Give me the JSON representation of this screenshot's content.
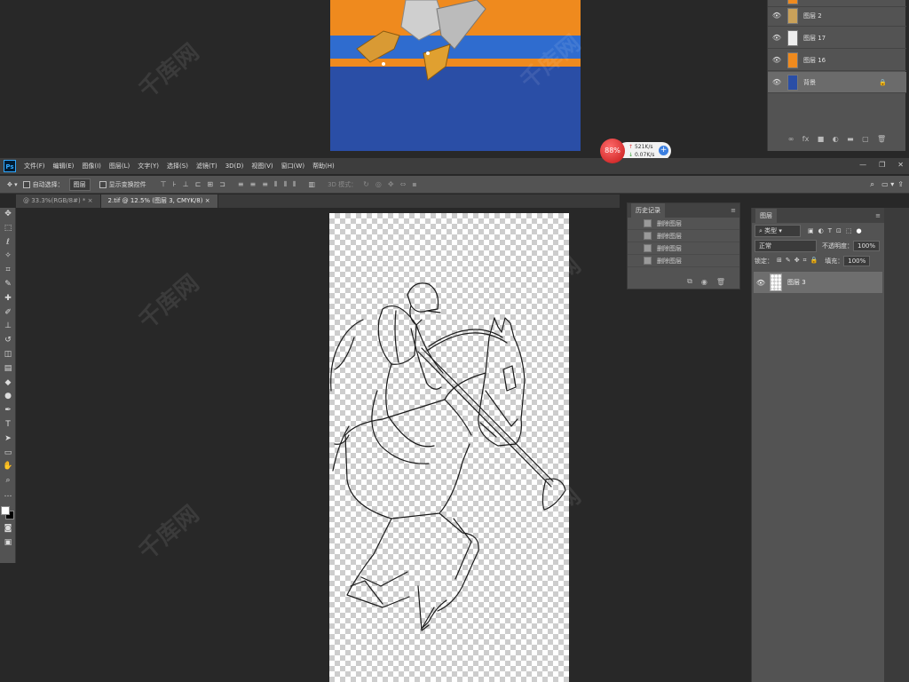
{
  "top_window": {
    "layers": [
      {
        "name": "图层 2"
      },
      {
        "name": "图层 17"
      },
      {
        "name": "图层 16"
      },
      {
        "name": "背景",
        "locked": true
      }
    ],
    "footer_icons": [
      "link-icon",
      "fx-icon",
      "mask-icon",
      "adjustment-icon",
      "folder-icon",
      "new-layer-icon",
      "trash-icon"
    ]
  },
  "speed_widget": {
    "percent": "88%",
    "upload": "521K/s",
    "download": "0.07K/s"
  },
  "menu": {
    "items": [
      "文件(F)",
      "编辑(E)",
      "图像(I)",
      "图层(L)",
      "文字(Y)",
      "选择(S)",
      "滤镜(T)",
      "3D(D)",
      "视图(V)",
      "窗口(W)",
      "帮助(H)"
    ]
  },
  "options": {
    "auto_select_label": "自动选择：",
    "auto_select_value": "图层",
    "transform_label": "显示变换控件",
    "mode_3d": "3D 模式："
  },
  "tabs": [
    {
      "label": "@ 33.3%(RGB/8#) *"
    },
    {
      "label": "2.tif @ 12.5% (图层 3, CMYK/8)"
    }
  ],
  "history": {
    "title": "历史记录",
    "items": [
      "删除图层",
      "删除图层",
      "删除图层",
      "删除图层"
    ]
  },
  "layers_panel": {
    "title": "图层",
    "filter_kind": "类型",
    "blend_mode": "正常",
    "opacity_label": "不透明度：",
    "opacity_value": "100%",
    "lock_label": "锁定：",
    "fill_label": "填充：",
    "fill_value": "100%",
    "layers": [
      {
        "name": "图层 3"
      }
    ]
  },
  "colors": {
    "orange": "#ef8a1e",
    "blue": "#2a4ea6",
    "ps_dark": "#282828"
  }
}
